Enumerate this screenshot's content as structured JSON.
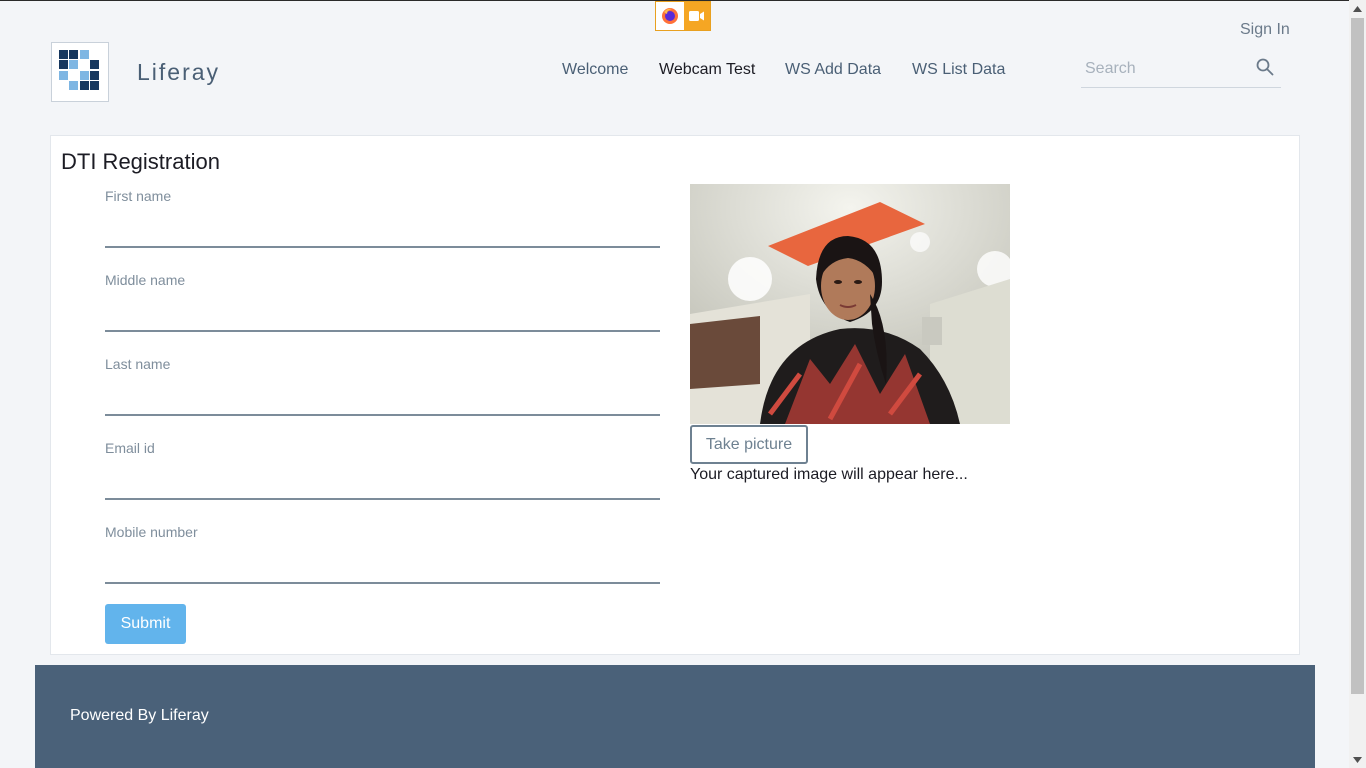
{
  "header": {
    "sign_in": "Sign In",
    "site_name": "Liferay",
    "nav": [
      {
        "label": "Welcome",
        "active": false
      },
      {
        "label": "Webcam Test",
        "active": true
      },
      {
        "label": "WS Add Data",
        "active": false
      },
      {
        "label": "WS List Data",
        "active": false
      }
    ],
    "search": {
      "placeholder": "Search",
      "value": ""
    }
  },
  "browser_indicator": {
    "icons": [
      "firefox-icon",
      "camera-sharing-icon"
    ],
    "accent": "#f5a623"
  },
  "form": {
    "title": "DTI Registration",
    "fields": [
      {
        "label": "First name",
        "value": ""
      },
      {
        "label": "Middle name",
        "value": ""
      },
      {
        "label": "Last name",
        "value": ""
      },
      {
        "label": "Email id",
        "value": ""
      },
      {
        "label": "Mobile number",
        "value": ""
      }
    ],
    "submit_label": "Submit"
  },
  "webcam": {
    "take_picture_label": "Take picture",
    "capture_note": "Your captured image will appear here..."
  },
  "footer": {
    "text": "Powered By Liferay"
  },
  "colors": {
    "primary": "#62b4ec",
    "footer": "#4a6179",
    "nav_text": "#4a5f75",
    "background": "#f3f5f8"
  }
}
